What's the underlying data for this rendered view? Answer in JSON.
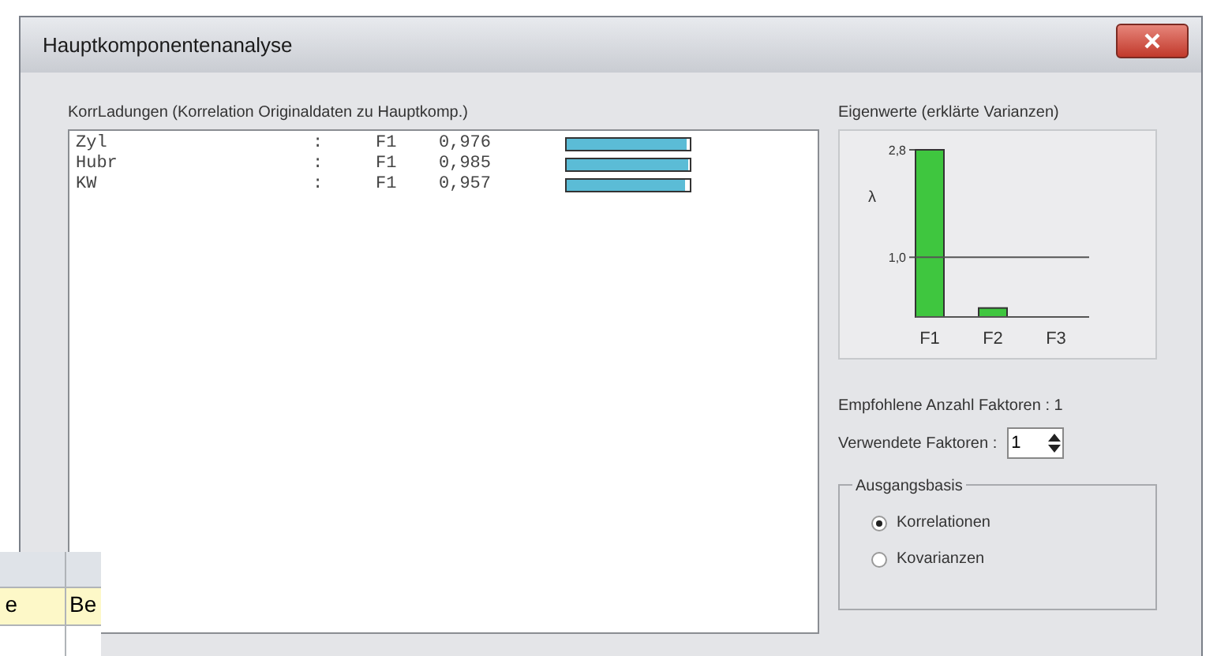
{
  "window": {
    "title": "Hauptkomponentenanalyse"
  },
  "loadings": {
    "title": "KorrLadungen (Korrelation Originaldaten zu Hauptkomp.)",
    "rows": [
      {
        "variable": "Zyl",
        "separator": ":",
        "factor": "F1",
        "value": "0,976",
        "level": 0.976
      },
      {
        "variable": "Hubr",
        "separator": ":",
        "factor": "F1",
        "value": "0,985",
        "level": 0.985
      },
      {
        "variable": "KW",
        "separator": ":",
        "factor": "F1",
        "value": "0,957",
        "level": 0.957
      }
    ]
  },
  "eigenvalues": {
    "title": "Eigenwerte (erklärte Varianzen)",
    "chart_data": {
      "type": "bar",
      "ylabel": "λ",
      "categories": [
        "F1",
        "F2",
        "F3"
      ],
      "values": [
        2.8,
        0.15,
        null
      ],
      "ylim": [
        0,
        2.8
      ],
      "yticks": [
        {
          "value": 1.0,
          "label": "1,0"
        },
        {
          "value": 2.8,
          "label": "2,8"
        }
      ]
    }
  },
  "recommended": {
    "label": "Empfohlene Anzahl Faktoren : 1"
  },
  "used_factors": {
    "label": "Verwendete Faktoren :",
    "value": "1"
  },
  "basis": {
    "title": "Ausgangsbasis",
    "options": [
      {
        "label": "Korrelationen",
        "selected": true
      },
      {
        "label": "Kovarianzen",
        "selected": false
      }
    ]
  },
  "background_sheet": {
    "row_1": [
      "e",
      "Be"
    ]
  }
}
